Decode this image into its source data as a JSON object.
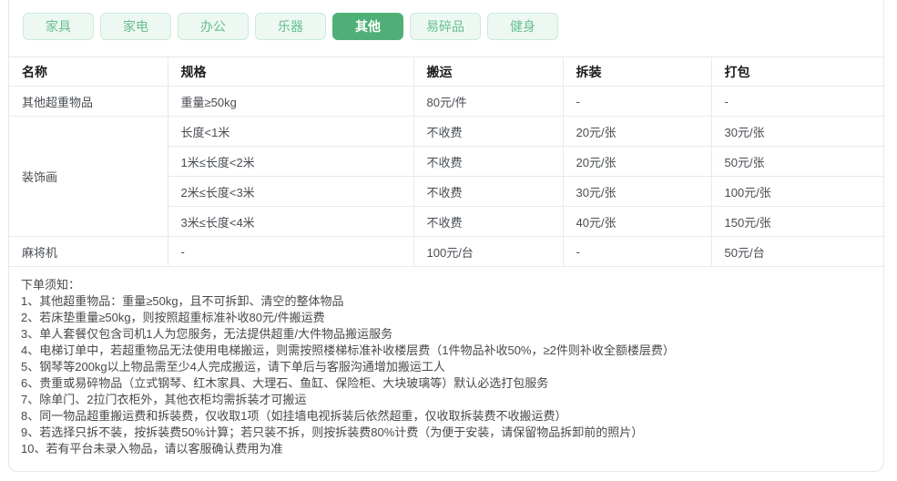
{
  "colors": {
    "accent": "#4fb077",
    "tab_bg": "#edf8f2",
    "tab_border": "#cbead8",
    "tab_text": "#67bf8e",
    "line": "#e9e9e9"
  },
  "tabs": {
    "items": [
      {
        "label": "家具",
        "active": false
      },
      {
        "label": "家电",
        "active": false
      },
      {
        "label": "办公",
        "active": false
      },
      {
        "label": "乐器",
        "active": false
      },
      {
        "label": "其他",
        "active": true
      },
      {
        "label": "易碎品",
        "active": false
      },
      {
        "label": "健身",
        "active": false
      }
    ]
  },
  "table": {
    "columns": [
      "名称",
      "规格",
      "搬运",
      "拆装",
      "打包"
    ],
    "rows": [
      {
        "cells": [
          {
            "t": "其他超重物品"
          },
          {
            "t": "重量≥50kg"
          },
          {
            "t": "80元/件"
          },
          {
            "t": "-"
          },
          {
            "t": "-"
          }
        ]
      },
      {
        "cells": [
          {
            "t": "装饰画",
            "rowspan": 4
          },
          {
            "t": "长度<1米"
          },
          {
            "t": "不收费"
          },
          {
            "t": "20元/张"
          },
          {
            "t": "30元/张"
          }
        ]
      },
      {
        "cells": [
          {
            "t": "1米≤长度<2米"
          },
          {
            "t": "不收费"
          },
          {
            "t": "20元/张"
          },
          {
            "t": "50元/张"
          }
        ]
      },
      {
        "cells": [
          {
            "t": "2米≤长度<3米"
          },
          {
            "t": "不收费"
          },
          {
            "t": "30元/张"
          },
          {
            "t": "100元/张"
          }
        ]
      },
      {
        "cells": [
          {
            "t": "3米≤长度<4米"
          },
          {
            "t": "不收费"
          },
          {
            "t": "40元/张"
          },
          {
            "t": "150元/张"
          }
        ]
      },
      {
        "cells": [
          {
            "t": "麻将机"
          },
          {
            "t": "-"
          },
          {
            "t": "100元/台"
          },
          {
            "t": "-"
          },
          {
            "t": "50元/台"
          }
        ]
      }
    ]
  },
  "notes": {
    "title": "下单须知：",
    "items": [
      "1、其他超重物品：重量≥50kg，且不可拆卸、清空的整体物品",
      "2、若床垫重量≥50kg，则按照超重标准补收80元/件搬运费",
      "3、单人套餐仅包含司机1人为您服务，无法提供超重/大件物品搬运服务",
      "4、电梯订单中，若超重物品无法使用电梯搬运，则需按照楼梯标准补收楼层费（1件物品补收50%，≥2件则补收全额楼层费）",
      "5、钢琴等200kg以上物品需至少4人完成搬运，请下单后与客服沟通增加搬运工人",
      "6、贵重或易碎物品（立式钢琴、红木家具、大理石、鱼缸、保险柜、大块玻璃等）默认必选打包服务",
      "7、除单门、2拉门衣柜外，其他衣柜均需拆装才可搬运",
      "8、同一物品超重搬运费和拆装费，仅收取1项（如挂墙电视拆装后依然超重，仅收取拆装费不收搬运费）",
      "9、若选择只拆不装，按拆装费50%计算；若只装不拆，则按拆装费80%计费（为便于安装，请保留物品拆卸前的照片）",
      "10、若有平台未录入物品，请以客服确认费用为准"
    ]
  }
}
